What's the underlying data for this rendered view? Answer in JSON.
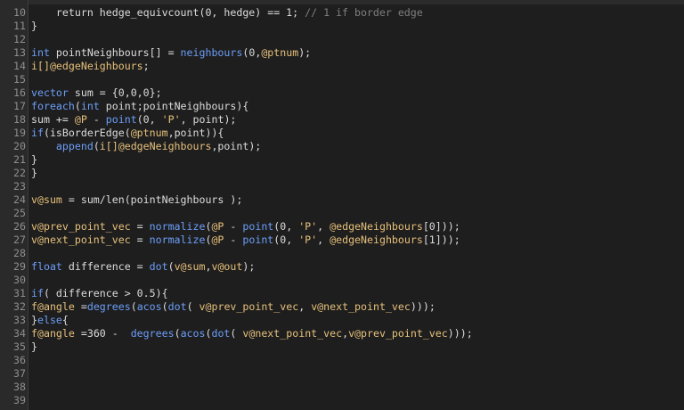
{
  "colors": {
    "background": "#1e1e1e",
    "gutter": "#2a2a2a",
    "line_number": "#8e8e8e",
    "text": "#dcdcdc",
    "keyword": "#6c9ef8",
    "attribute": "#e6c07b",
    "comment": "#7f7f7f"
  },
  "lines": [
    {
      "n": "10",
      "t": [
        [
          "op",
          "    return hedge_equivcount(0, hedge) == 1; "
        ],
        [
          "cm",
          "// 1 if border edge"
        ]
      ]
    },
    {
      "n": "11",
      "t": [
        [
          "op",
          "}"
        ]
      ]
    },
    {
      "n": "12",
      "t": []
    },
    {
      "n": "13",
      "t": [
        [
          "kw",
          "int"
        ],
        [
          "op",
          " pointNeighbours[] = "
        ],
        [
          "fn",
          "neighbours"
        ],
        [
          "op",
          "(0,"
        ],
        [
          "attr",
          "@ptnum"
        ],
        [
          "op",
          ");"
        ]
      ]
    },
    {
      "n": "14",
      "t": [
        [
          "attr",
          "i[]@edgeNeighbours"
        ],
        [
          "op",
          ";"
        ]
      ]
    },
    {
      "n": "15",
      "t": []
    },
    {
      "n": "16",
      "t": [
        [
          "kw",
          "vector"
        ],
        [
          "op",
          " sum = {0,0,0};"
        ]
      ]
    },
    {
      "n": "17",
      "t": [
        [
          "kw",
          "foreach"
        ],
        [
          "op",
          "("
        ],
        [
          "kw",
          "int"
        ],
        [
          "op",
          " point;pointNeighbours){"
        ]
      ]
    },
    {
      "n": "18",
      "t": [
        [
          "op",
          "sum += "
        ],
        [
          "attr",
          "@P"
        ],
        [
          "op",
          " - "
        ],
        [
          "fn",
          "point"
        ],
        [
          "op",
          "(0, "
        ],
        [
          "str",
          "'P'"
        ],
        [
          "op",
          ", point);"
        ]
      ]
    },
    {
      "n": "19",
      "t": [
        [
          "kw",
          "if"
        ],
        [
          "op",
          "(isBorderEdge("
        ],
        [
          "attr",
          "@ptnum"
        ],
        [
          "op",
          ",point)){"
        ]
      ]
    },
    {
      "n": "20",
      "t": [
        [
          "op",
          "    "
        ],
        [
          "fn",
          "append"
        ],
        [
          "op",
          "("
        ],
        [
          "attr",
          "i[]@edgeNeighbours"
        ],
        [
          "op",
          ",point);"
        ]
      ]
    },
    {
      "n": "21",
      "t": [
        [
          "op",
          "}"
        ]
      ]
    },
    {
      "n": "22",
      "t": [
        [
          "op",
          "}"
        ]
      ]
    },
    {
      "n": "23",
      "t": []
    },
    {
      "n": "24",
      "t": [
        [
          "attr",
          "v@sum"
        ],
        [
          "op",
          " = sum/len(pointNeighbours );"
        ]
      ]
    },
    {
      "n": "25",
      "t": []
    },
    {
      "n": "26",
      "t": [
        [
          "attr",
          "v@prev_point_vec"
        ],
        [
          "op",
          " = "
        ],
        [
          "fn",
          "normalize"
        ],
        [
          "op",
          "("
        ],
        [
          "attr",
          "@P"
        ],
        [
          "op",
          " - "
        ],
        [
          "fn",
          "point"
        ],
        [
          "op",
          "(0, "
        ],
        [
          "str",
          "'P'"
        ],
        [
          "op",
          ", "
        ],
        [
          "attr",
          "@edgeNeighbours"
        ],
        [
          "op",
          "[0]));"
        ]
      ]
    },
    {
      "n": "27",
      "t": [
        [
          "attr",
          "v@next_point_vec"
        ],
        [
          "op",
          " = "
        ],
        [
          "fn",
          "normalize"
        ],
        [
          "op",
          "("
        ],
        [
          "attr",
          "@P"
        ],
        [
          "op",
          " - "
        ],
        [
          "fn",
          "point"
        ],
        [
          "op",
          "(0, "
        ],
        [
          "str",
          "'P'"
        ],
        [
          "op",
          ", "
        ],
        [
          "attr",
          "@edgeNeighbours"
        ],
        [
          "op",
          "[1]));"
        ]
      ]
    },
    {
      "n": "28",
      "t": []
    },
    {
      "n": "29",
      "t": [
        [
          "kw",
          "float"
        ],
        [
          "op",
          " difference = "
        ],
        [
          "fn",
          "dot"
        ],
        [
          "op",
          "("
        ],
        [
          "attr",
          "v@sum"
        ],
        [
          "op",
          ","
        ],
        [
          "attr",
          "v@out"
        ],
        [
          "op",
          ");"
        ]
      ]
    },
    {
      "n": "30",
      "t": []
    },
    {
      "n": "31",
      "t": [
        [
          "kw",
          "if"
        ],
        [
          "op",
          "( difference > 0.5){"
        ]
      ]
    },
    {
      "n": "32",
      "t": [
        [
          "attr",
          "f@angle"
        ],
        [
          "op",
          " ="
        ],
        [
          "fn",
          "degrees"
        ],
        [
          "op",
          "("
        ],
        [
          "fn",
          "acos"
        ],
        [
          "op",
          "("
        ],
        [
          "fn",
          "dot"
        ],
        [
          "op",
          "( "
        ],
        [
          "attr",
          "v@prev_point_vec"
        ],
        [
          "op",
          ", "
        ],
        [
          "attr",
          "v@next_point_vec"
        ],
        [
          "op",
          ")));"
        ]
      ]
    },
    {
      "n": "33",
      "t": [
        [
          "op",
          "}"
        ],
        [
          "kw",
          "else"
        ],
        [
          "op",
          "{"
        ]
      ]
    },
    {
      "n": "34",
      "t": [
        [
          "attr",
          "f@angle"
        ],
        [
          "op",
          " =360 -  "
        ],
        [
          "fn",
          "degrees"
        ],
        [
          "op",
          "("
        ],
        [
          "fn",
          "acos"
        ],
        [
          "op",
          "("
        ],
        [
          "fn",
          "dot"
        ],
        [
          "op",
          "( "
        ],
        [
          "attr",
          "v@next_point_vec"
        ],
        [
          "op",
          ","
        ],
        [
          "attr",
          "v@prev_point_vec"
        ],
        [
          "op",
          ")));"
        ]
      ]
    },
    {
      "n": "35",
      "t": [
        [
          "op",
          "}"
        ]
      ]
    },
    {
      "n": "36",
      "t": []
    },
    {
      "n": "37",
      "t": []
    },
    {
      "n": "38",
      "t": []
    },
    {
      "n": "39",
      "t": []
    }
  ]
}
